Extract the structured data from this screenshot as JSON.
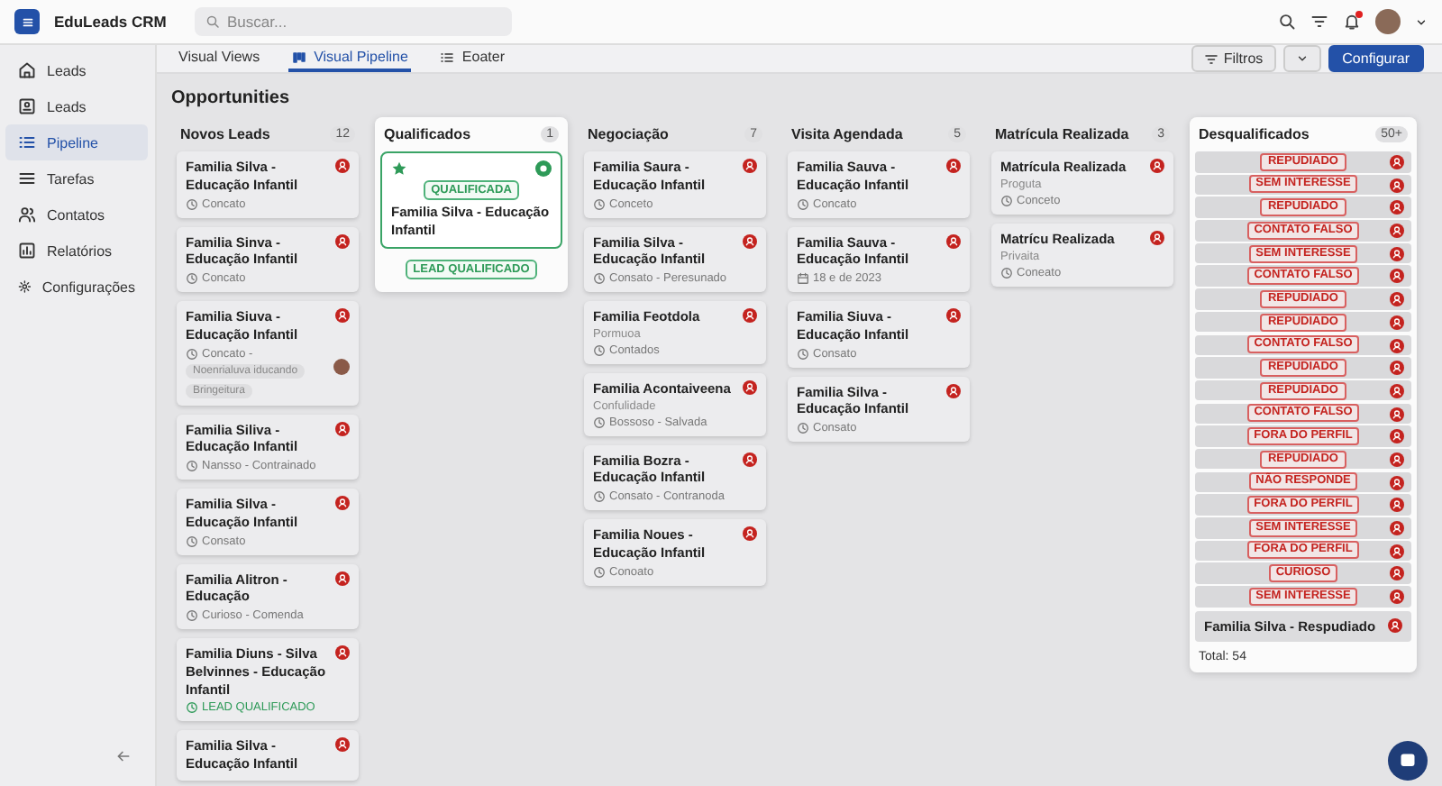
{
  "app": {
    "name": "EduLeads CRM"
  },
  "search": {
    "placeholder": "Buscar..."
  },
  "notifications": {
    "unread": true
  },
  "sidebar": {
    "items": [
      {
        "label": "Leads",
        "selected": false
      },
      {
        "label": "Leads",
        "selected": false
      },
      {
        "label": "Pipeline",
        "selected": true
      },
      {
        "label": "Tarefas",
        "selected": false
      },
      {
        "label": "Contatos",
        "selected": false
      },
      {
        "label": "Relatórios",
        "selected": false
      },
      {
        "label": "Configurações",
        "selected": false
      }
    ]
  },
  "tabs": [
    {
      "label": "Visual Views",
      "selected": false
    },
    {
      "label": "Visual Pipeline",
      "selected": true
    },
    {
      "label": "Eoater",
      "selected": false
    }
  ],
  "toolbar": {
    "filter": "Filtros",
    "configure": "Configurar"
  },
  "board": {
    "title": "Opportunities",
    "columns": [
      {
        "kind": "cards",
        "title": "Novos Leads",
        "count": "12",
        "highlighted": false,
        "cards": [
          {
            "title": "Familia Silva - Educação Infantil",
            "meta": "Concato",
            "qualified": false
          },
          {
            "title": "Familia Sinva - Educação Infantil",
            "meta": "Concato",
            "qualified": false
          },
          {
            "title": "Familia Siuva - Educação Infantil",
            "meta": "Concato -",
            "tags": [
              "Noenrialuva iducando",
              "Bringeitura"
            ],
            "avatar": true,
            "qualified": false
          },
          {
            "title": "Familia Siliva - Educação Infantil",
            "meta": "Nansso - Contrainado",
            "qualified": false
          },
          {
            "title": "Familia Silva - Educação Infantil",
            "meta": "Consato",
            "qualified": false
          },
          {
            "title": "Familia Alitron - Educação",
            "meta": "Curioso - Comenda",
            "qualified": false
          },
          {
            "title": "Familia Diuns - Silva Belvinnes - Educação Infantil",
            "meta": "LEAD QUALIFICADO",
            "qualified": true
          },
          {
            "title": "Familia Silva - Educação Infantil"
          }
        ]
      },
      {
        "kind": "featured",
        "title": "Qualificados",
        "count": "1",
        "highlighted": true,
        "cards": [
          {
            "title": "Familia Silva - Educação Infantil",
            "badge": "QUALIFICADA",
            "footer": "LEAD QUALIFICADO"
          }
        ]
      },
      {
        "kind": "cards",
        "title": "Negociação",
        "count": "7",
        "highlighted": false,
        "cards": [
          {
            "title": "Familia Saura - Educação Infantil",
            "meta": "Conceto"
          },
          {
            "title": "Familia Silva - Educação Infantil",
            "meta": "Consato - Peresunado"
          },
          {
            "title": "Familia Feotdola",
            "subtitle": "Pormuoa",
            "meta": "Contados"
          },
          {
            "title": "Familia Acontaiveena",
            "subtitle": "Confulidade",
            "meta": "Bossoso - Salvada"
          },
          {
            "title": "Familia Bozra - Educação Infantil",
            "meta": "Consato - Contranoda"
          },
          {
            "title": "Familia Noues - Educação Infantil",
            "meta": "Conoato"
          }
        ]
      },
      {
        "kind": "cards",
        "title": "Visita Agendada",
        "count": "5",
        "highlighted": false,
        "cards": [
          {
            "kind": "status",
            "title": "Familia Sauva - Educação Infantil",
            "meta": "Concato"
          },
          {
            "kind": "date",
            "title": "Familia Sauva - Educação Infantil",
            "meta": "18  e de 2023"
          },
          {
            "kind": "status",
            "title": "Familia Siuva - Educação Infantil",
            "meta": "Consato"
          },
          {
            "kind": "status",
            "title": "Familia Silva - Educação Infantil",
            "meta": "Consato"
          }
        ]
      },
      {
        "kind": "cards",
        "title": "Matrícula Realizada",
        "count": "3",
        "highlighted": false,
        "cards": [
          {
            "title": "Matrícula Realizada",
            "subtitle": "Proguta",
            "meta": "Conceto"
          },
          {
            "title": "Matrícu Realizada",
            "subtitle": "Privaita",
            "meta": "Coneato"
          }
        ]
      },
      {
        "kind": "tags",
        "title": "Desqualificados",
        "count": "50+",
        "highlighted": true,
        "tags": [
          "REPUDIADO",
          "SEM INTERESSE",
          "REPUDIADO",
          "CONTATO FALSO",
          "SEM INTERESSE",
          "CONTATO FALSO",
          "REPUDIADO",
          "REPUDIADO",
          "CONTATO FALSO",
          "REPUDIADO",
          "REPUDIADO",
          "CONTATO FALSO",
          "FORA DO PERFIL",
          "REPUDIADO",
          "NÃO RESPONDE",
          "FORA DO PERFIL",
          "SEM INTERESSE",
          "FORA DO PERFIL",
          "CURIOSO",
          "SEM INTERESSE"
        ],
        "last_card": "Familia Silva - Respudiado",
        "total": "Total: 54"
      }
    ]
  }
}
